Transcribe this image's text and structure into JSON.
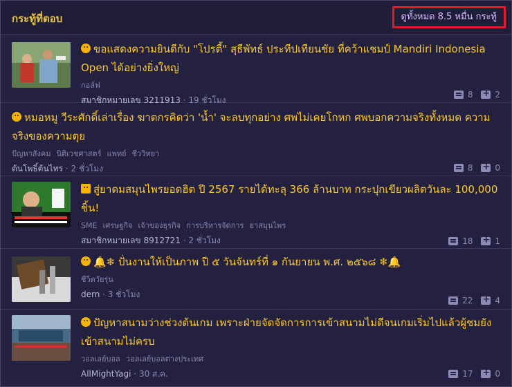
{
  "header": {
    "title": "กระทู้ที่ตอบ",
    "view_all": "ดูทั้งหมด 8.5 หมื่น กระทู้"
  },
  "colors": {
    "accent": "#fcc933",
    "highlight_box": "#e41a2a",
    "background": "#23213f"
  },
  "topics": [
    {
      "title": "ขอแสดงความยินดีกับ \"โปรตี้\" สุธีพัทธ์ ประทีปเทียนชัย ที่คว้าแชมป์ Mandiri Indonesia Open ได้อย่างยิ่งใหญ่",
      "tags": [
        "กอล์ฟ"
      ],
      "author": "สมาชิกหมายเลข 3211913",
      "time": "· 19 ชั่วโมง",
      "comments": "8",
      "votes": "2",
      "icon": "emoji-icon"
    },
    {
      "title": "หมอหมู วีระศักดิ์เล่าเรื่อง ฆาตกรคิดว่า 'น้ำ' จะลบทุกอย่าง ศพไม่เคยโกหก ศพบอกความจริงทั้งหมด ความจริงของความตุย",
      "tags": [
        "ปัญหาสังคม",
        "นิติเวชศาสตร์",
        "แพทย์",
        "ชีววิทยา"
      ],
      "author": "ต้นโพธิ์ต้นไทร",
      "time": "· 2 ชั่วโมง",
      "comments": "8",
      "votes": "0",
      "icon": "emoji-icon"
    },
    {
      "title": "สู่ยาดมสมุนไพรยอดฮิต ปี 2567 รายได้ทะลุ 366 ล้านบาท กระปุกเขียวผลิตวันละ 100,000 ชิ้น!",
      "tags": [
        "SME",
        "เศรษฐกิจ",
        "เจ้าของธุรกิจ",
        "การบริหารจัดการ",
        "ยาสมุนไพร"
      ],
      "author": "สมาชิกหมายเลข 8912721",
      "time": "· 2 ชั่วโมง",
      "comments": "18",
      "votes": "1",
      "icon": "video-icon"
    },
    {
      "title": "🔔❄ ปั่นงานให้เป็นภาพ ปี ๕ วันจันทร์ที่ ๑ กันยายน พ.ศ. ๒๕๖๘ ❄🔔",
      "tags": [
        "ชีวิตวัยรุ่น"
      ],
      "author": "dern",
      "time": "· 3 ชั่วโมง",
      "comments": "22",
      "votes": "4",
      "icon": "emoji-icon"
    },
    {
      "title": "ปัญหาสนามว่างช่วงต้นเกม เพราะฝ่ายจัดจัดการการเข้าสนามไม่ดีจนเกมเริ่มไปแล้วผู้ชมยังเข้าสนามไม่ครบ",
      "tags": [
        "วอลเลย์บอล",
        "วอลเลย์บอลต่างประเทศ"
      ],
      "author": "AllMightYagi",
      "time": "· 30 ส.ค.",
      "comments": "17",
      "votes": "0",
      "icon": "emoji-icon"
    }
  ]
}
